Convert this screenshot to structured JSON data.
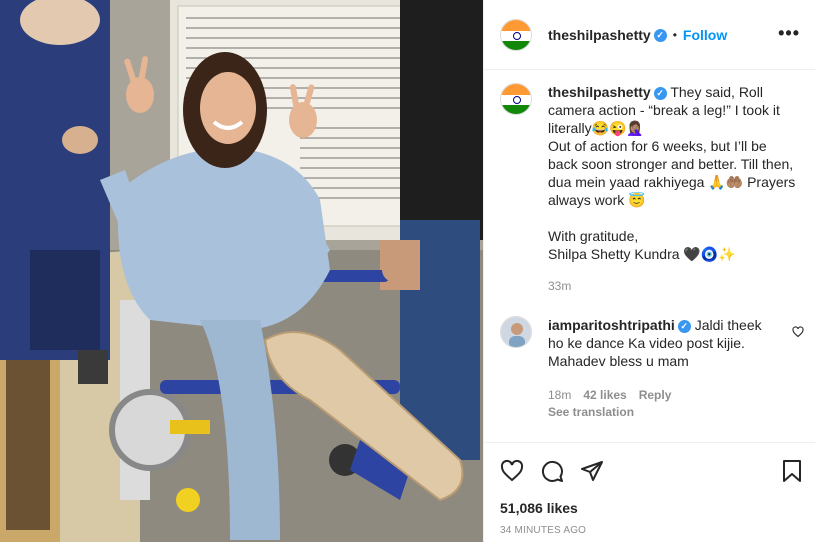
{
  "post": {
    "username": "theshilpashetty",
    "follow_label": "Follow",
    "more_label": "•••",
    "verified_mark": "✓",
    "separator": "•"
  },
  "caption": {
    "username": "theshilpashetty",
    "line1": "They said, Roll camera action - “break a leg!” I took it literally😂😜🤦🏽‍♀️",
    "line2": "Out of action for 6 weeks, but I’ll be back soon stronger and better. Till then, dua mein yaad rakhiyega 🙏🤲🏽 Prayers always work 😇",
    "line3": "With gratitude,",
    "line4": "Shilpa Shetty Kundra 🖤🧿✨",
    "time": "33m"
  },
  "comment": {
    "username": "iamparitoshtripathi",
    "text": "Jaldi theek ho ke dance Ka video post kijie. Mahadev bless u mam",
    "time": "18m",
    "likes": "42 likes",
    "reply_label": "Reply",
    "see_translation_label": "See translation"
  },
  "actions": {
    "likes": "51,086 likes",
    "posted": "34 MINUTES AGO"
  },
  "icons": {
    "like": "heart-icon",
    "comment": "comment-icon",
    "share": "share-icon",
    "save": "bookmark-icon",
    "comment_like": "small-heart-icon"
  },
  "colors": {
    "accent": "#0095f6",
    "verified": "#3897f0",
    "text": "#262626",
    "muted": "#8e8e8e"
  }
}
